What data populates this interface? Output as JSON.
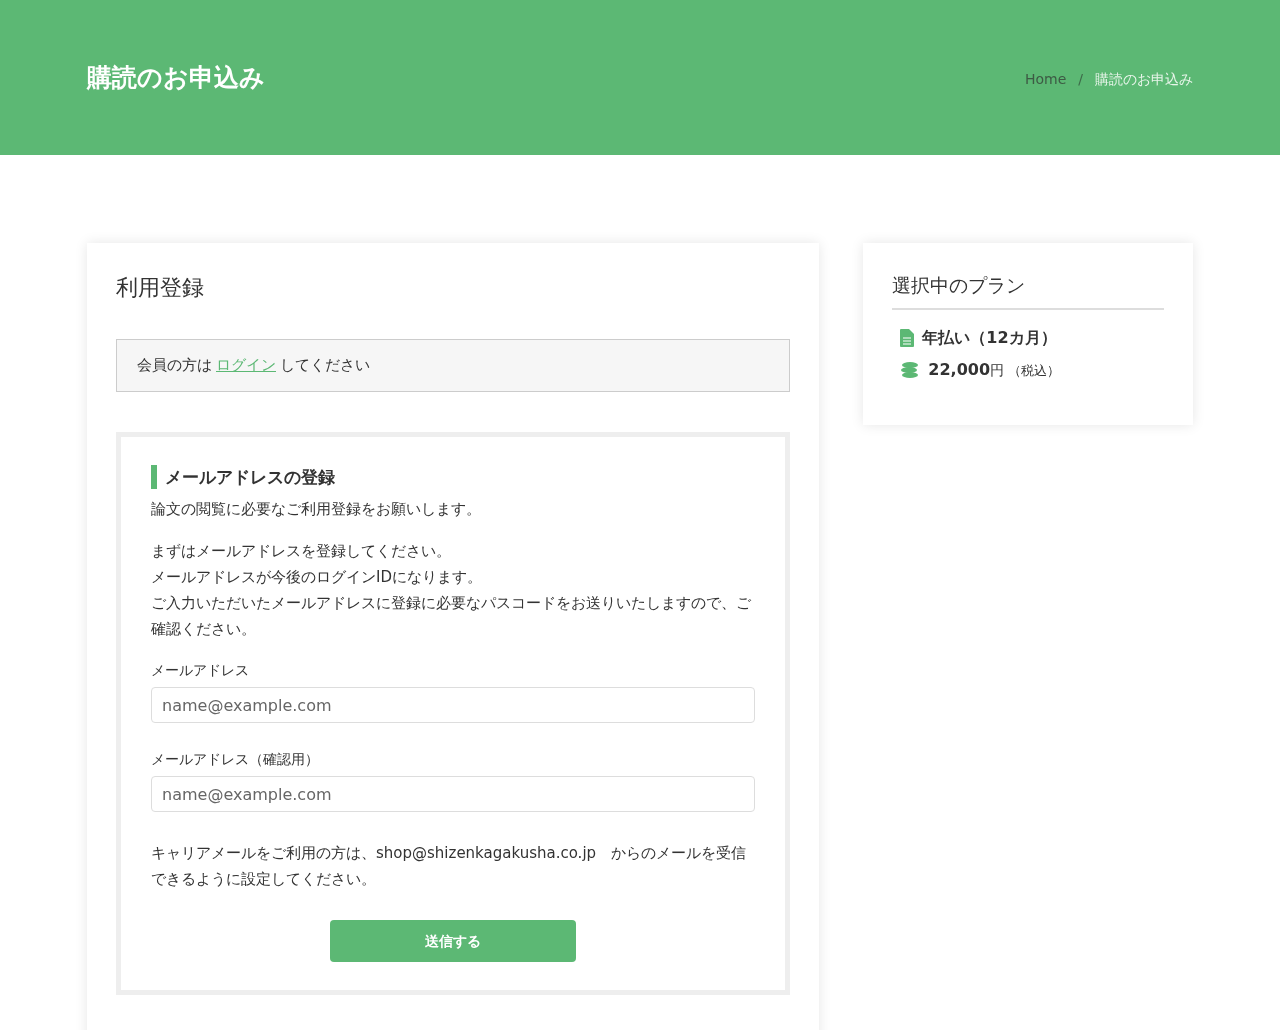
{
  "header": {
    "title": "購読のお申込み",
    "separator": "/",
    "breadcrumb": [
      {
        "label": "Home",
        "selected": false
      },
      {
        "label": "購読のお申込み",
        "selected": true
      }
    ]
  },
  "main": {
    "title": "利用登録",
    "notice": {
      "before": "会員の方は",
      "link": "ログイン",
      "after": "してください"
    },
    "form": {
      "heading": "メールアドレスの登録",
      "lead": "論文の閲覧に必要なご利用登録をお願いします。",
      "description": [
        "まずはメールアドレスを登録してください。",
        "メールアドレスが今後のログインIDになります。",
        "ご入力いただいたメールアドレスに登録に必要なパスコードをお送りいたしますので、ご確認ください。"
      ],
      "fields": [
        {
          "label": "メールアドレス",
          "placeholder": "name@example.com"
        },
        {
          "label": "メールアドレス（確認用）",
          "placeholder": "name@example.com"
        }
      ],
      "carrier_note": "キャリアメールをご利用の方は、shop@shizenkagakusha.co.jp　からのメールを受信できるように設定してください。",
      "submit": "送信する"
    }
  },
  "sidebar": {
    "title": "選択中のプラン",
    "plan": "年払い（12カ月）",
    "price": "22,000",
    "currency": "円",
    "tax_note": "（税込）"
  }
}
